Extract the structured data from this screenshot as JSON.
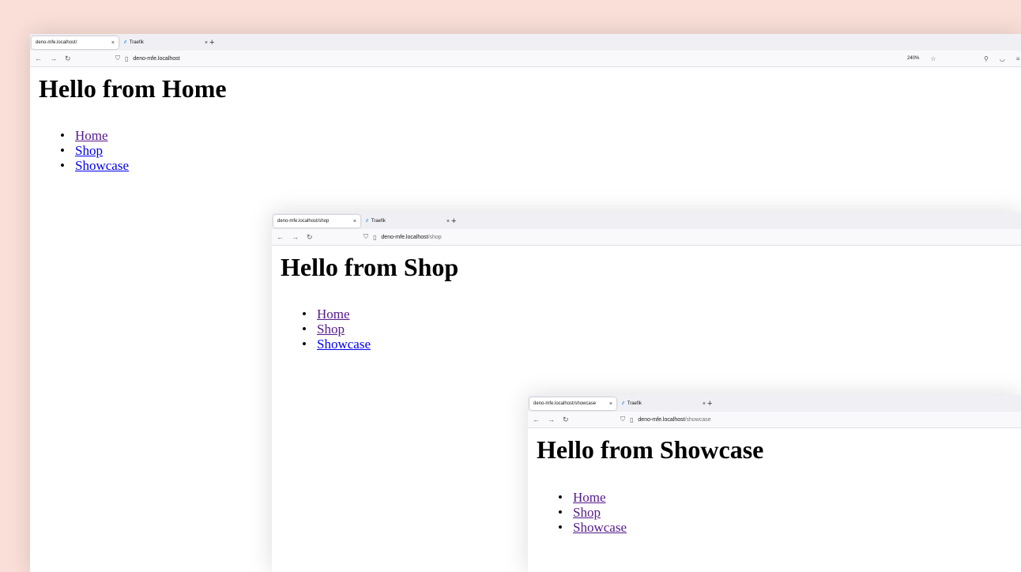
{
  "theme": {
    "backdrop": "#f9dfd8",
    "link": "#0000ee",
    "visited": "#551a8b"
  },
  "windows": {
    "home": {
      "active_tab": "deno-mfe.localhost/",
      "other_tab": "Traefik",
      "url_host": "deno-mfe.localhost",
      "url_path": "",
      "zoom": "240%",
      "heading": "Hello from Home",
      "links": [
        "Home",
        "Shop",
        "Showcase"
      ]
    },
    "shop": {
      "active_tab": "deno-mfe.localhost/shop",
      "other_tab": "Traefik",
      "url_host": "deno-mfe.localhost",
      "url_path": "/shop",
      "heading": "Hello from Shop",
      "links": [
        "Home",
        "Shop",
        "Showcase"
      ]
    },
    "showcase": {
      "active_tab": "deno-mfe.localhost/showcase",
      "other_tab": "Traefik",
      "url_host": "deno-mfe.localhost",
      "url_path": "/showcase",
      "heading": "Hello from Showcase",
      "links": [
        "Home",
        "Shop",
        "Showcase"
      ]
    }
  },
  "icons": {
    "back": "back-arrow-icon",
    "forward": "forward-arrow-icon",
    "reload": "reload-icon",
    "shield": "tracking-protection-icon",
    "page": "page-icon",
    "star": "bookmark-star-icon",
    "extensions": "extensions-icon",
    "pocket": "pocket-icon",
    "menu": "hamburger-menu-icon",
    "favicon": "traefik-favicon-icon"
  },
  "symbols": {
    "close": "×",
    "new_tab": "+",
    "bullet": "•"
  }
}
